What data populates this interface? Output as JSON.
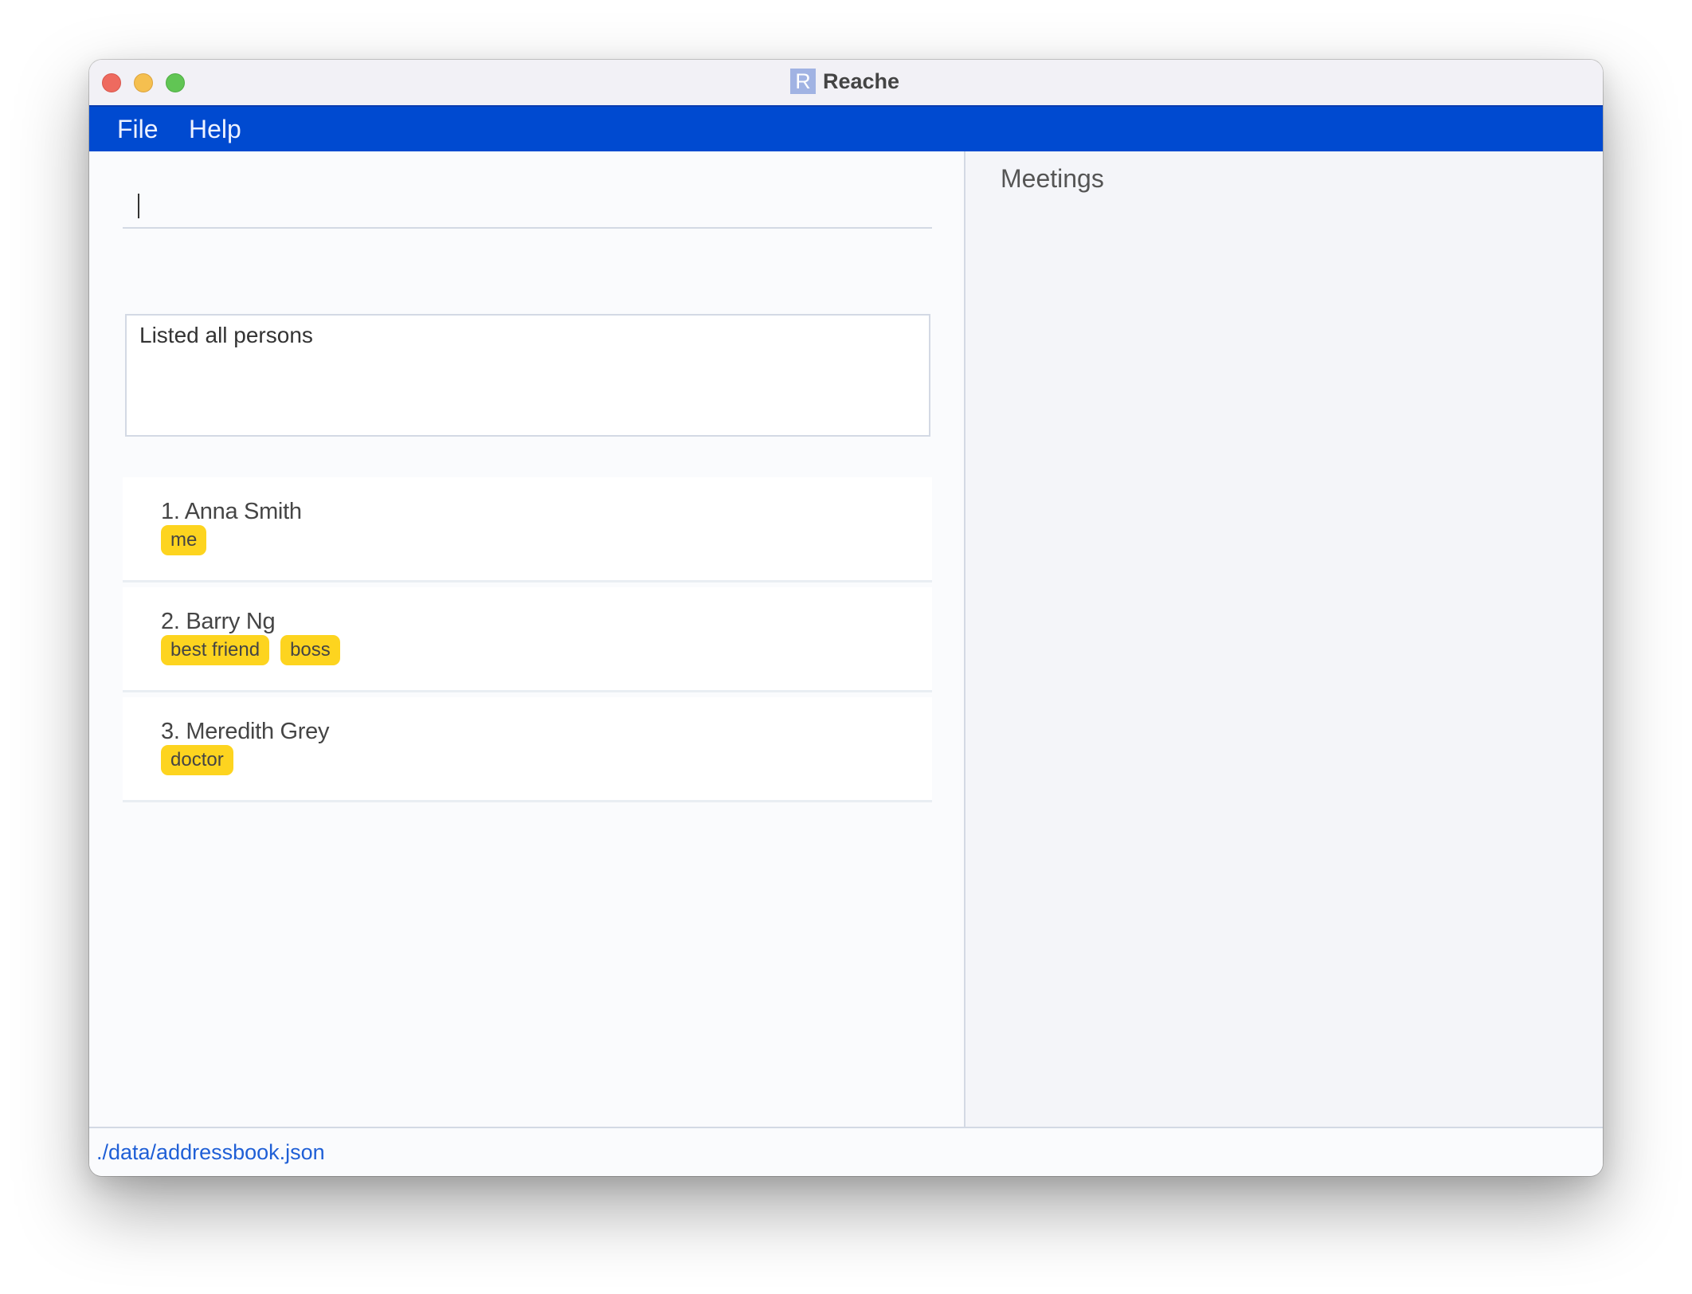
{
  "window": {
    "title": "Reache",
    "app_icon_letter": "R",
    "traffic_lights": [
      "close",
      "minimize",
      "maximize"
    ]
  },
  "menubar": {
    "items": [
      {
        "label": "File"
      },
      {
        "label": "Help"
      }
    ]
  },
  "command": {
    "value": "",
    "placeholder": ""
  },
  "result": {
    "text": "Listed all persons"
  },
  "persons": [
    {
      "index": "1.",
      "name": "Anna Smith",
      "display": "1. Anna Smith",
      "tags": [
        "me"
      ]
    },
    {
      "index": "2.",
      "name": "Barry Ng",
      "display": "2. Barry Ng",
      "tags": [
        "best friend",
        "boss"
      ]
    },
    {
      "index": "3.",
      "name": "Meredith Grey",
      "display": "3. Meredith Grey",
      "tags": [
        "doctor"
      ]
    }
  ],
  "meetings": {
    "title": "Meetings",
    "items": []
  },
  "statusbar": {
    "path": "./data/addressbook.json"
  },
  "colors": {
    "menubar": "#004ad0",
    "tag": "#fdd41f",
    "status_text": "#1f5fd6"
  }
}
